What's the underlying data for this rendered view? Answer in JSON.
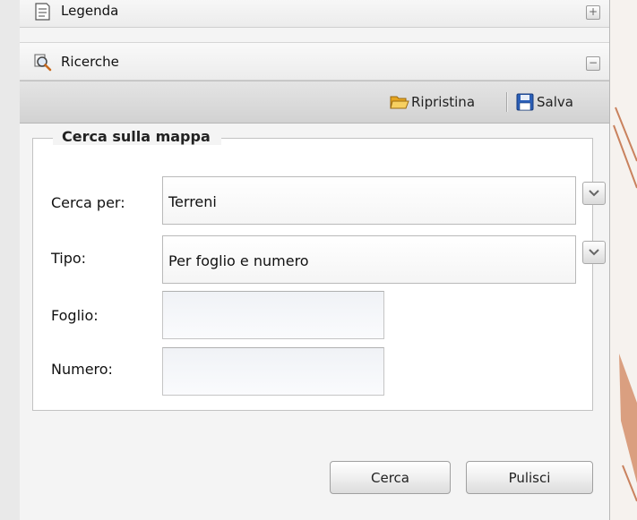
{
  "accordion": {
    "legenda": {
      "label": "Legenda",
      "toggle": "+",
      "icon": "document-icon"
    },
    "ricerche": {
      "label": "Ricerche",
      "toggle": "−",
      "icon": "search-magnifier-icon"
    }
  },
  "toolbar": {
    "ripristina_label": "Ripristina",
    "ripristina_icon": "open-folder-icon",
    "salva_label": "Salva",
    "salva_icon": "floppy-disk-icon"
  },
  "form": {
    "legend": "Cerca sulla mappa",
    "cerca_per": {
      "label": "Cerca per:",
      "value": "Terreni"
    },
    "tipo": {
      "label": "Tipo:",
      "value": "Per foglio e numero"
    },
    "foglio": {
      "label": "Foglio:",
      "value": ""
    },
    "numero": {
      "label": "Numero:",
      "value": ""
    }
  },
  "buttons": {
    "cerca": "Cerca",
    "pulisci": "Pulisci"
  },
  "colors": {
    "panel_bg": "#f4f4f4",
    "toolbar_bg": "#d9d9d9",
    "map_accent": "#c0704a",
    "folder_yellow": "#f0c040",
    "floppy_blue": "#2b5fb8"
  }
}
